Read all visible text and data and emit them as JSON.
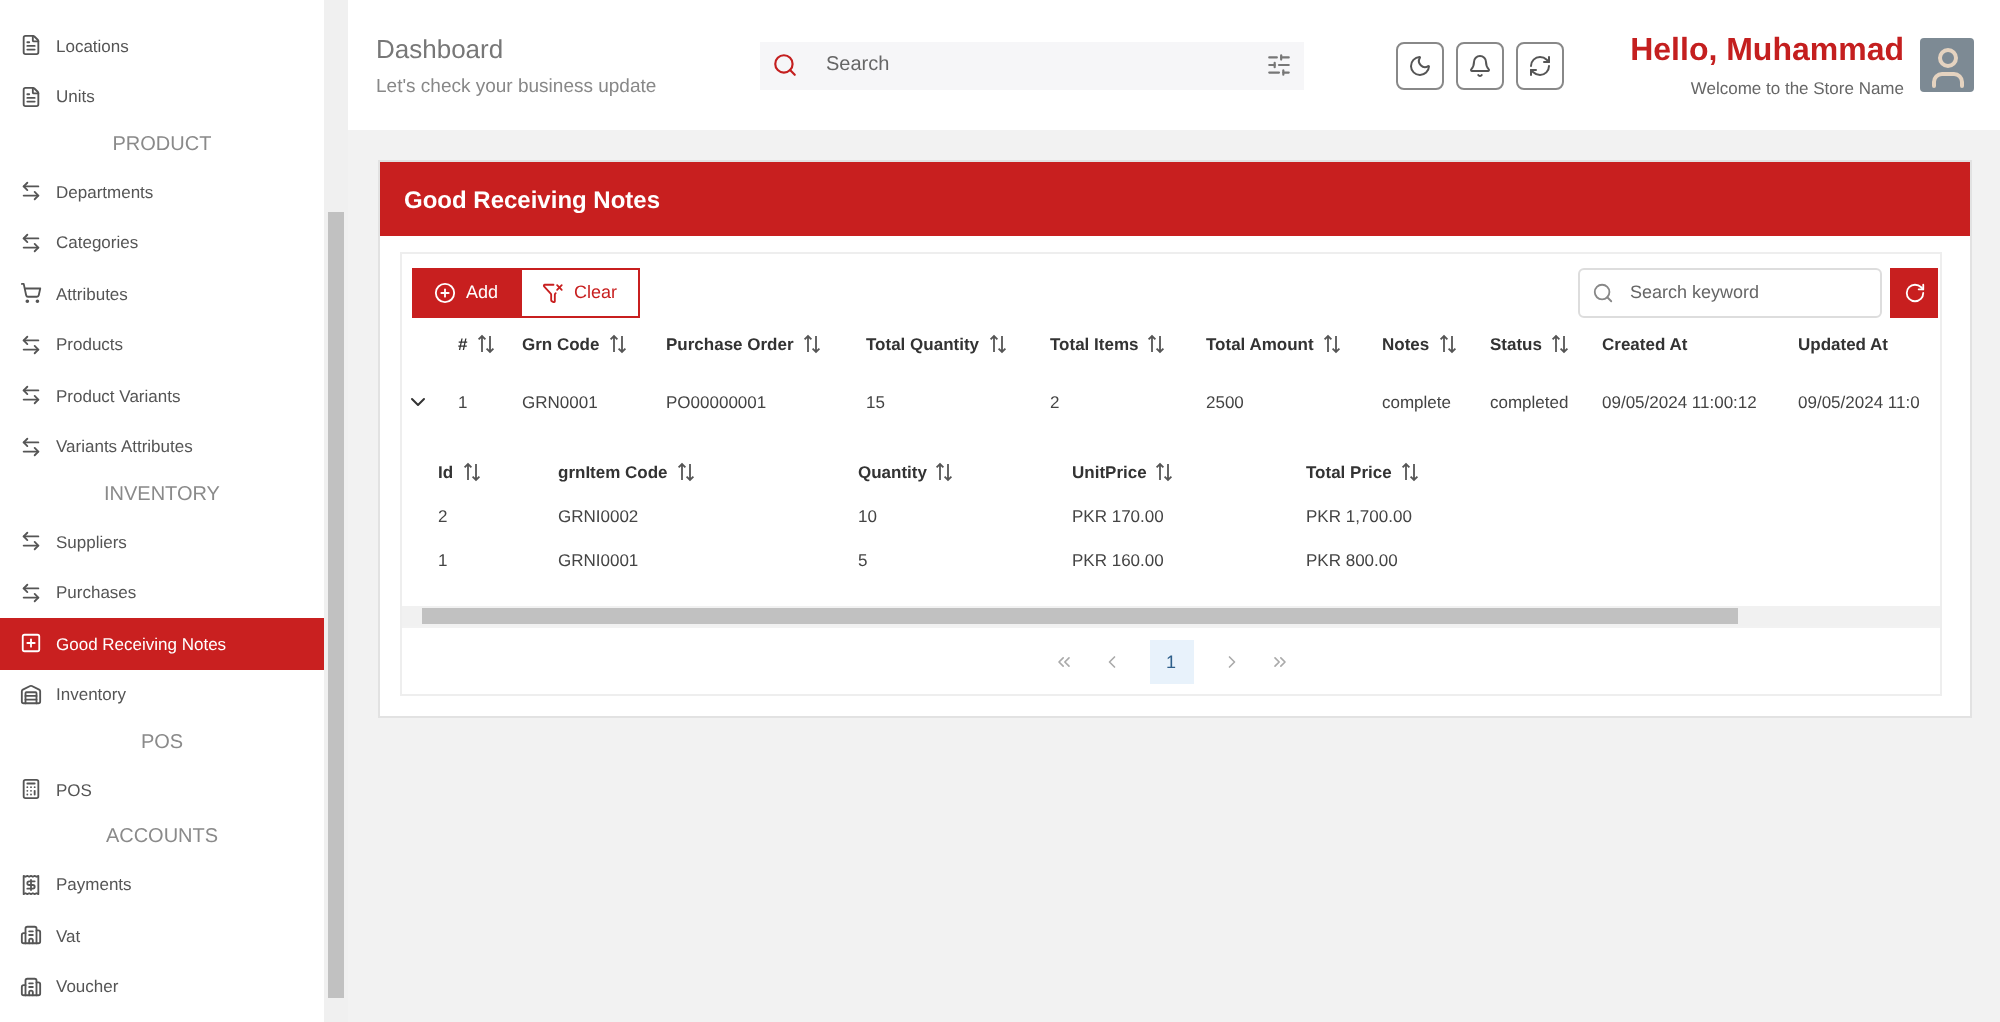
{
  "sidebar": {
    "sections": [
      {
        "items": [
          {
            "label": "Locations",
            "kind": "document",
            "selected": false
          },
          {
            "label": "Units",
            "kind": "document",
            "selected": false
          }
        ]
      },
      {
        "title": "PRODUCT",
        "items": [
          {
            "label": "Departments",
            "kind": "swap",
            "selected": false
          },
          {
            "label": "Categories",
            "kind": "swap",
            "selected": false
          },
          {
            "label": "Attributes",
            "kind": "cart",
            "selected": false
          },
          {
            "label": "Products",
            "kind": "swap",
            "selected": false
          },
          {
            "label": "Product Variants",
            "kind": "swap",
            "selected": false
          },
          {
            "label": "Variants Attributes",
            "kind": "swap",
            "selected": false
          }
        ]
      },
      {
        "title": "INVENTORY",
        "items": [
          {
            "label": "Suppliers",
            "kind": "swap",
            "selected": false
          },
          {
            "label": "Purchases",
            "kind": "swap",
            "selected": false
          },
          {
            "label": "Good Receiving Notes",
            "kind": "note",
            "selected": true
          },
          {
            "label": "Inventory",
            "kind": "warehouse",
            "selected": false
          }
        ]
      },
      {
        "title": "POS",
        "items": [
          {
            "label": "POS",
            "kind": "terminal",
            "selected": false
          }
        ]
      },
      {
        "title": "ACCOUNTS",
        "items": [
          {
            "label": "Payments",
            "kind": "payment",
            "selected": false
          },
          {
            "label": "Vat",
            "kind": "building",
            "selected": false
          },
          {
            "label": "Voucher",
            "kind": "building",
            "selected": false
          }
        ]
      }
    ]
  },
  "header": {
    "title": "Dashboard",
    "subtitle": "Let's check your business update",
    "search": {
      "placeholder": "Search"
    },
    "greeting": "Hello, Muhammad",
    "welcome": "Welcome to the Store Name"
  },
  "card": {
    "title": "Good Receiving Notes",
    "add_button": "Add",
    "clear_button": "Clear",
    "search": {
      "placeholder": "Search keyword"
    },
    "table": {
      "columns": [
        {
          "label": "#",
          "sortable": true
        },
        {
          "label": "Grn Code",
          "sortable": true
        },
        {
          "label": "Purchase Order",
          "sortable": true
        },
        {
          "label": "Total Quantity",
          "sortable": true
        },
        {
          "label": "Total Items",
          "sortable": true
        },
        {
          "label": "Total Amount",
          "sortable": true
        },
        {
          "label": "Notes",
          "sortable": true
        },
        {
          "label": "Status",
          "sortable": true
        },
        {
          "label": "Created At",
          "sortable": false
        },
        {
          "label": "Updated At",
          "sortable": false
        }
      ],
      "rows": [
        {
          "expanded": true,
          "cells": [
            "1",
            "GRN0001",
            "PO00000001",
            "15",
            "2",
            "2500",
            "complete",
            "completed",
            "09/05/2024 11:00:12",
            "09/05/2024 11:0"
          ],
          "sub_table": {
            "columns": [
              "Id",
              "grnItem Code",
              "Quantity",
              "UnitPrice",
              "Total Price"
            ],
            "rows": [
              [
                "2",
                "GRNI0002",
                "10",
                "PKR 170.00",
                "PKR 1,700.00"
              ],
              [
                "1",
                "GRNI0001",
                "5",
                "PKR 160.00",
                "PKR 800.00"
              ]
            ]
          }
        }
      ]
    },
    "pagination": {
      "pages": [
        {
          "label": "1",
          "selected": true
        }
      ]
    }
  }
}
